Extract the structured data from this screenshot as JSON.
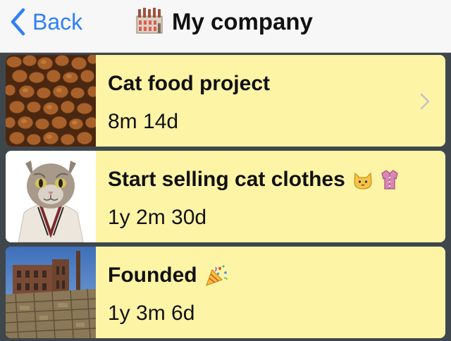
{
  "nav": {
    "back_label": "Back",
    "title": "My company",
    "title_icon": "factory-icon",
    "accent": "#2f7ff7"
  },
  "rows": [
    {
      "title": "Cat food project",
      "duration": "8m 14d",
      "thumbnail": "cat-food-image",
      "has_disclosure": true
    },
    {
      "title": "Start selling cat clothes",
      "duration": "1y 2m 30d",
      "thumbnail": "cat-in-suit-image",
      "emojis": [
        "cat-face-icon",
        "blouse-icon"
      ]
    },
    {
      "title": "Founded",
      "duration": "1y 3m 6d",
      "thumbnail": "factory-building-image",
      "emojis": [
        "party-popper-icon"
      ]
    }
  ],
  "colors": {
    "row_background": "#fdf4a6",
    "separator": "#3f464c",
    "navbar": "#f7f7f7"
  }
}
